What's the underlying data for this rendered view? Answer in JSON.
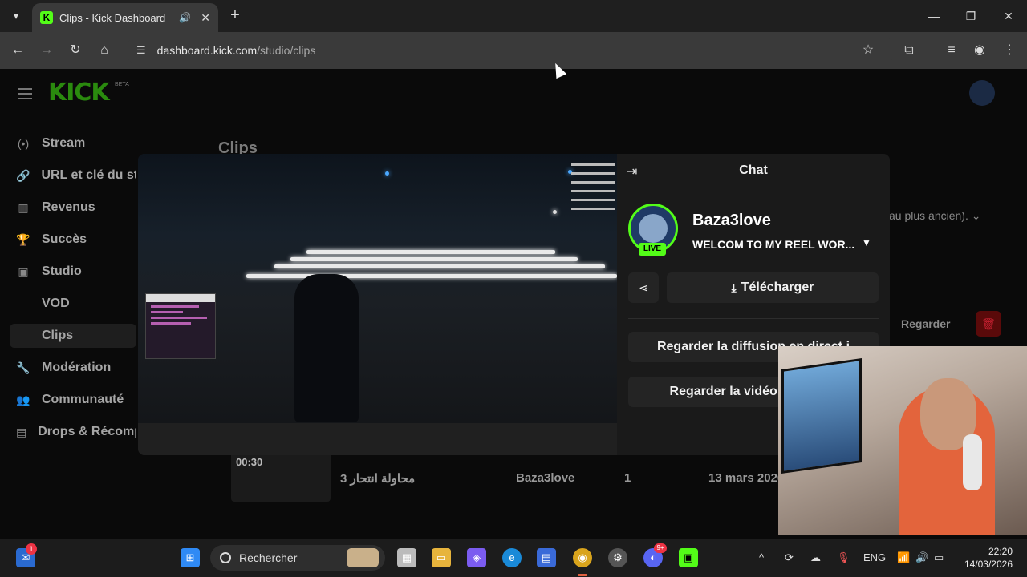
{
  "browser": {
    "tab_title": "Clips - Kick Dashboard",
    "url_host": "dashboard.kick.com",
    "url_path": "/studio/clips",
    "favicon_letter": "K"
  },
  "kick": {
    "logo": "KICK",
    "beta": "BETA",
    "sidebar": {
      "items": [
        {
          "label": "Stream",
          "icon": "stream-icon"
        },
        {
          "label": "URL et clé du stream",
          "icon": "link-icon"
        },
        {
          "label": "Revenus",
          "icon": "revenue-icon"
        },
        {
          "label": "Succès",
          "icon": "trophy-icon"
        },
        {
          "label": "Studio",
          "icon": "studio-icon"
        },
        {
          "label": "Modération",
          "icon": "wrench-icon"
        },
        {
          "label": "Communauté",
          "icon": "community-icon"
        },
        {
          "label": "Drops & Récompenses",
          "icon": "drops-icon"
        }
      ],
      "studio_sub": [
        "VOD",
        "Clips"
      ]
    },
    "page_title": "Clips",
    "sort_label": "au plus ancien).",
    "row_action": "Regarder",
    "clip_row": {
      "duration": "00:30",
      "title": "محاولة انتحار 3",
      "author": "Baza3love",
      "views": "1",
      "date": "13 mars 2026"
    }
  },
  "modal": {
    "chat_title": "Chat",
    "channel_name": "Baza3love",
    "stream_title": "WELCOM TO MY REEL WOR...",
    "live_badge": "LIVE",
    "download_label": "Télécharger",
    "watch_stream_label": "Regarder la diffusion en direct ⁠i",
    "watch_video_label": "Regarder la vidéo complète"
  },
  "taskbar": {
    "search_placeholder": "Rechercher",
    "language": "ENG",
    "time": "22:20",
    "date": "14/03/2026",
    "notification_count": "1",
    "discord_badge": "9+"
  },
  "colors": {
    "kick_green": "#53fc18",
    "page_bg": "#0a0a0a",
    "modal_bg": "#1a1a1a"
  }
}
